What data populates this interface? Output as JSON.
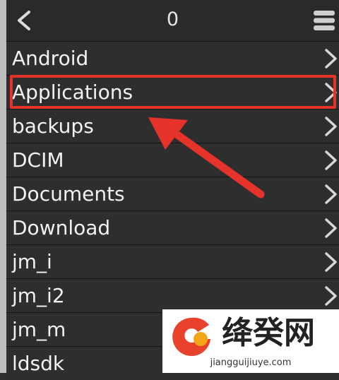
{
  "header": {
    "title": "0"
  },
  "folders": [
    {
      "label": "Android"
    },
    {
      "label": "Applications"
    },
    {
      "label": "backups"
    },
    {
      "label": "DCIM"
    },
    {
      "label": "Documents"
    },
    {
      "label": "Download"
    },
    {
      "label": "jm_i"
    },
    {
      "label": "jm_i2"
    },
    {
      "label": "jm_m"
    },
    {
      "label": "ldsdk"
    }
  ],
  "annotation": {
    "highlight_color": "#e5322a"
  },
  "watermark": {
    "brand": "绛癸网",
    "url": "jiangguijiuye.com"
  },
  "colors": {
    "background": "#2d2d2d",
    "text": "#f2f2f2",
    "accent": "#e5322a"
  }
}
